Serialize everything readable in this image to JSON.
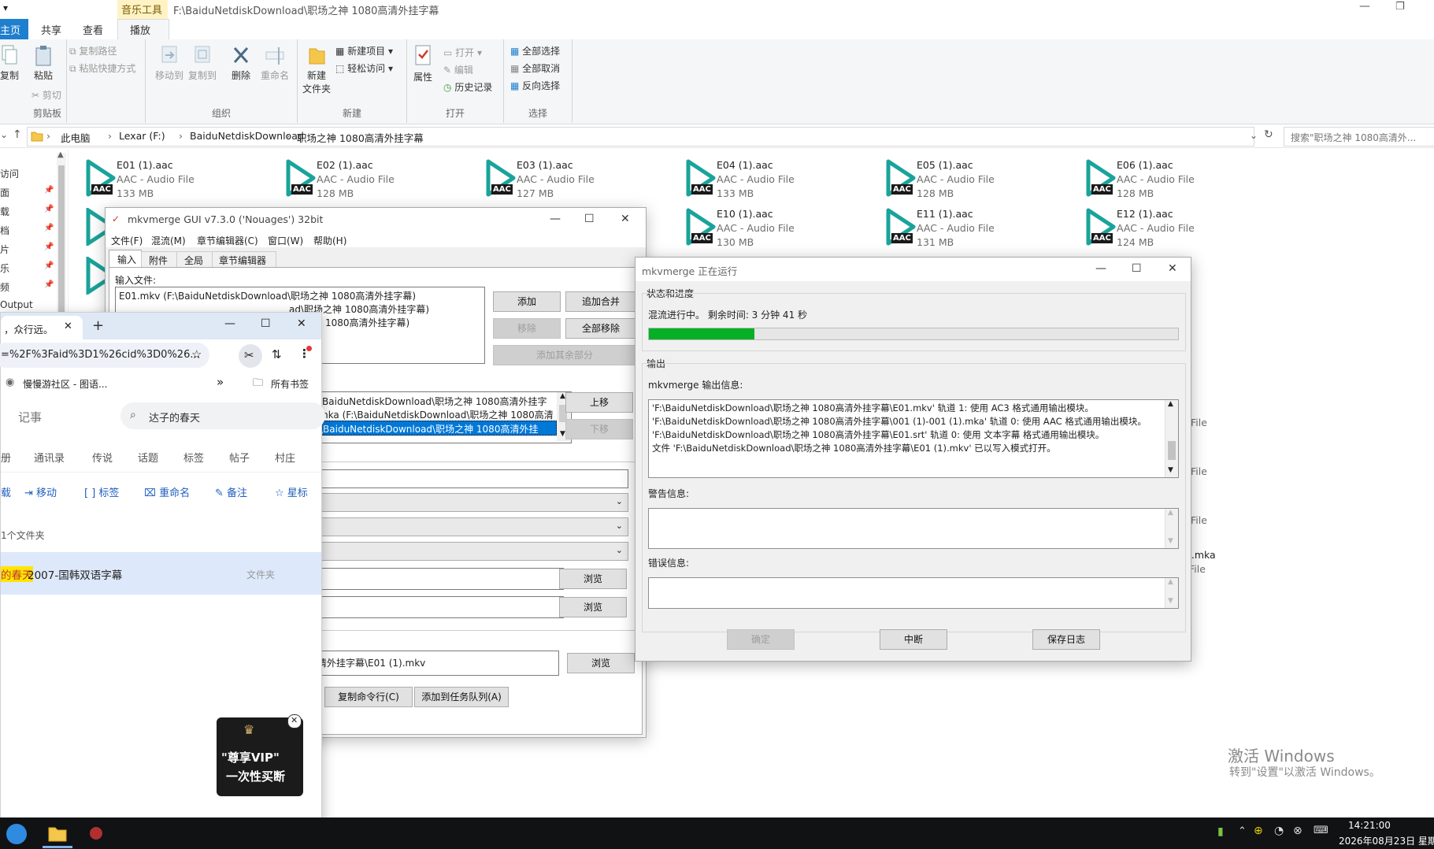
{
  "explorer": {
    "title_path": "F:\\BaiduNetdiskDownload\\职场之神 1080高清外挂字幕",
    "context_tab": "音乐工具",
    "tabs": [
      "主页",
      "共享",
      "查看",
      "播放"
    ],
    "clipboard": {
      "copy": "复制",
      "paste": "粘贴",
      "copy_path": "复制路径",
      "paste_shortcut": "粘贴快捷方式",
      "cut": "剪切",
      "group": "剪贴板"
    },
    "organize": {
      "move_to": "移动到",
      "copy_to": "复制到",
      "delete": "删除",
      "rename": "重命名",
      "group": "组织"
    },
    "new": {
      "new_folder": "新建\n文件夹",
      "new_item": "新建项目",
      "easy_access": "轻松访问",
      "group": "新建"
    },
    "open": {
      "properties": "属性",
      "open": "打开",
      "edit": "编辑",
      "history": "历史记录",
      "group": "打开"
    },
    "select": {
      "select_all": "全部选择",
      "select_none": "全部取消",
      "invert": "反向选择",
      "group": "选择"
    },
    "breadcrumb": [
      "此电脑",
      "Lexar (F:)",
      "BaiduNetdiskDownload",
      "职场之神 1080高清外挂字幕"
    ],
    "search_placeholder": "搜索\"职场之神 1080高清外...",
    "nav_items": [
      "访问",
      "面",
      "载",
      "档",
      "片",
      "乐",
      "频",
      "Output"
    ],
    "files_row1": [
      {
        "name": "E01 (1).aac",
        "type": "AAC - Audio File",
        "size": "133 MB"
      },
      {
        "name": "E02 (1).aac",
        "type": "AAC - Audio File",
        "size": "128 MB"
      },
      {
        "name": "E03 (1).aac",
        "type": "AAC - Audio File",
        "size": "127 MB"
      },
      {
        "name": "E04 (1).aac",
        "type": "AAC - Audio File",
        "size": "133 MB"
      },
      {
        "name": "E05 (1).aac",
        "type": "AAC - Audio File",
        "size": "128 MB"
      },
      {
        "name": "E06 (1).aac",
        "type": "AAC - Audio File",
        "size": "128 MB"
      }
    ],
    "files_row2": [
      {
        "name": "E10 (1).aac",
        "type": "AAC - Audio File",
        "size": "130 MB"
      },
      {
        "name": "E11 (1).aac",
        "type": "AAC - Audio File",
        "size": "131 MB"
      },
      {
        "name": "E12 (1).aac",
        "type": "AAC - Audio File",
        "size": "124 MB"
      }
    ],
    "aac_badge": "AAC",
    "right_fragments": [
      "File",
      "File",
      "File",
      ").mka",
      "File"
    ]
  },
  "mkvgui": {
    "title": "mkvmerge GUI v7.3.0 ('Nouages') 32bit",
    "menu": [
      "文件(F)",
      "混流(M)",
      "章节编辑器(C)",
      "窗口(W)",
      "帮助(H)"
    ],
    "tabs": [
      "输入",
      "附件",
      "全局",
      "章节编辑器"
    ],
    "input_files_label": "输入文件:",
    "input_files": [
      "E01.mkv (F:\\BaiduNetdiskDownload\\职场之神  1080高清外挂字幕)",
      "ad\\职场之神  1080高清外挂字幕)",
      "1080高清外挂字幕)"
    ],
    "btn_add": "添加",
    "btn_append": "追加合并",
    "btn_remove": "移除",
    "btn_remove_all": "全部移除",
    "btn_add_other": "添加其余部分",
    "tracks": [
      "\\BaiduNetdiskDownload\\职场之神  1080高清外挂字",
      "mka (F:\\BaiduNetdiskDownload\\职场之神  1080高清",
      "\\BaiduNetdiskDownload\\职场之神  1080高清外挂"
    ],
    "btn_up": "上移",
    "btn_down": "下移",
    "btn_browse": "浏览",
    "output_value": "清外挂字幕\\E01 (1).mkv",
    "btn_copy_cmd": "复制命令行(C)",
    "btn_add_queue": "添加到任务队列(A)"
  },
  "browser": {
    "tab_title": "，众行远。",
    "url": "=%2F%3Faid%3D1%26cid%3D0%26...",
    "bookmark": "慢慢游社区 - 图语...",
    "all_bookmarks": "所有书签",
    "app_title": "记事",
    "search_value": "达子的春天",
    "nav": [
      "册",
      "通讯录",
      "传说",
      "话题",
      "标签",
      "帖子",
      "村庄"
    ],
    "actions": [
      "载",
      "移动",
      "标签",
      "重命名",
      "备注",
      "星标"
    ],
    "folder_count": "1个文件夹",
    "row_highlight": "的春天",
    "row_rest": "2007-国韩双语字幕",
    "row_type": "文件夹",
    "vip_line1": "\"尊享VIP\"",
    "vip_line2": "一次性买断"
  },
  "progress": {
    "title": "mkvmerge 正在运行",
    "status_group": "状态和进度",
    "status_text": "混流进行中。  剩余时间: 3 分钟 41 秒",
    "progress_fraction": 0.2,
    "output_group": "输出",
    "output_label": "mkvmerge 输出信息:",
    "output_lines": [
      "'F:\\BaiduNetdiskDownload\\职场之神  1080高清外挂字幕\\E01.mkv' 轨道 1: 使用 AC3 格式通用输出模块。",
      "'F:\\BaiduNetdiskDownload\\职场之神  1080高清外挂字幕\\001 (1)-001 (1).mka' 轨道 0: 使用 AAC 格式通用输出模块。",
      "'F:\\BaiduNetdiskDownload\\职场之神  1080高清外挂字幕\\E01.srt' 轨道 0: 使用 文本字幕 格式通用输出模块。",
      "文件 'F:\\BaiduNetdiskDownload\\职场之神  1080高清外挂字幕\\E01 (1).mkv' 已以写入模式打开。"
    ],
    "warning_label": "警告信息:",
    "error_label": "错误信息:",
    "btn_ok": "确定",
    "btn_abort": "中断",
    "btn_save_log": "保存日志"
  },
  "desktop": {
    "activate_title": "激活 Windows",
    "activate_sub": "转到\"设置\"以激活 Windows。",
    "time": "14:21:00",
    "date": "2026年08月23日 星期"
  },
  "colors": {
    "accent": "#1f7fcf",
    "progress": "#06b025",
    "icon_teal": "#1aa39a",
    "selection": "#0078d7"
  }
}
